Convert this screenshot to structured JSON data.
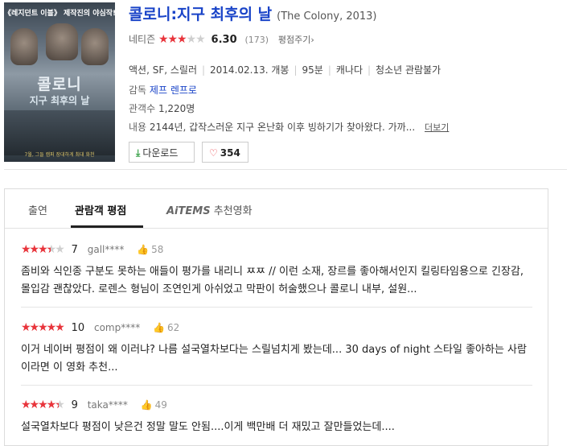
{
  "poster": {
    "tagline": "《레지던트 이블》 제작진의 야심작!",
    "title": "콜로니",
    "subtitle": "지구 최후의 날",
    "credit": "7월, 그들 캠퍼 장대하게 최대 화천"
  },
  "movie": {
    "title": "콜로니:지구 최후의 날",
    "original_title": "(The Colony, 2013)",
    "rating_label": "네티즌",
    "rating_score": "6.30",
    "rating_stars_filled": 3,
    "rating_count": "(173)",
    "rate_link": "평점주기",
    "genre": "액션, SF, 스릴러",
    "release": "2014.02.13. 개봉",
    "runtime": "95분",
    "country": "캐나다",
    "age": "청소년 관람불가",
    "director_label": "감독",
    "director": "제프 렌프로",
    "audience_label": "관객수",
    "audience": "1,220명",
    "plot_label": "내용",
    "plot": "2144년, 갑작스러운 지구 온난화 이후 빙하기가 찾아왔다. 가까...",
    "more_label": "더보기",
    "download_label": "다운로드",
    "likes": "354"
  },
  "tabs": {
    "cast": "출연",
    "reviews": "관람객 평점",
    "aitems_logo": "AiTEMS",
    "aitems_suffix": "추천영화"
  },
  "reviews": [
    {
      "stars": 3.5,
      "score": "7",
      "user": "gall****",
      "likes": "58",
      "text": "좀비와 식인종 구분도 못하는 애들이 평가를 내리니 ㅉㅉ // 이런 소재, 장르를 좋아해서인지 킬링타임용으로 긴장감, 몰입감 괜찮았다. 로렌스 형님이 조연인게 아쉬었고 막판이 허술했으나 콜로니 내부, 설원..."
    },
    {
      "stars": 5,
      "score": "10",
      "user": "comp****",
      "likes": "62",
      "text": "이거 네이버 평점이 왜 이러냐? 나름 설국열차보다는 스릴넘치게 봤는데... 30 days of night 스타일 좋아하는 사람이라면 이 영화 추천..."
    },
    {
      "stars": 4.5,
      "score": "9",
      "user": "taka****",
      "likes": "49",
      "text": "설국열차보다 평점이 낮은건 정말 말도 안됨....이게 백만배 더 재밌고 잘만들었는데...."
    }
  ]
}
